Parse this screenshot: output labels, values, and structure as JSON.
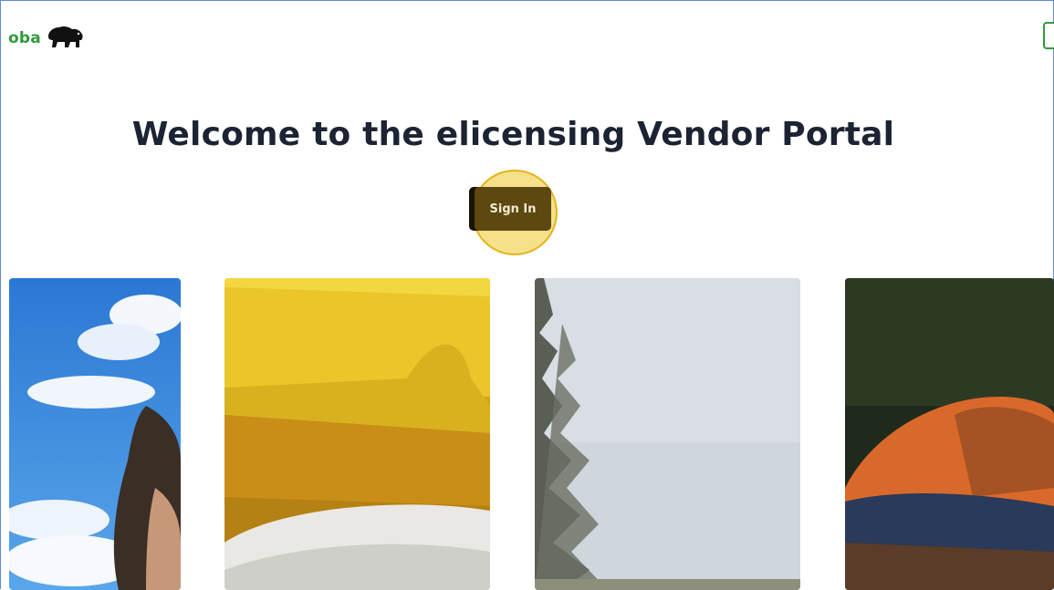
{
  "header": {
    "logo_text": "oba",
    "logo_icon": "bison-icon"
  },
  "main": {
    "title": "Welcome to the elicensing Vendor Portal",
    "signin_label": "Sign In"
  },
  "cards": [
    {
      "name": "card-sky-person"
    },
    {
      "name": "card-yellow-object"
    },
    {
      "name": "card-trees-sky"
    },
    {
      "name": "card-orange-cap"
    }
  ],
  "colors": {
    "brand_green": "#2f9a3d",
    "title_text": "#1c2333",
    "signin_bg": "#5c4810",
    "highlight": "#efc728"
  }
}
